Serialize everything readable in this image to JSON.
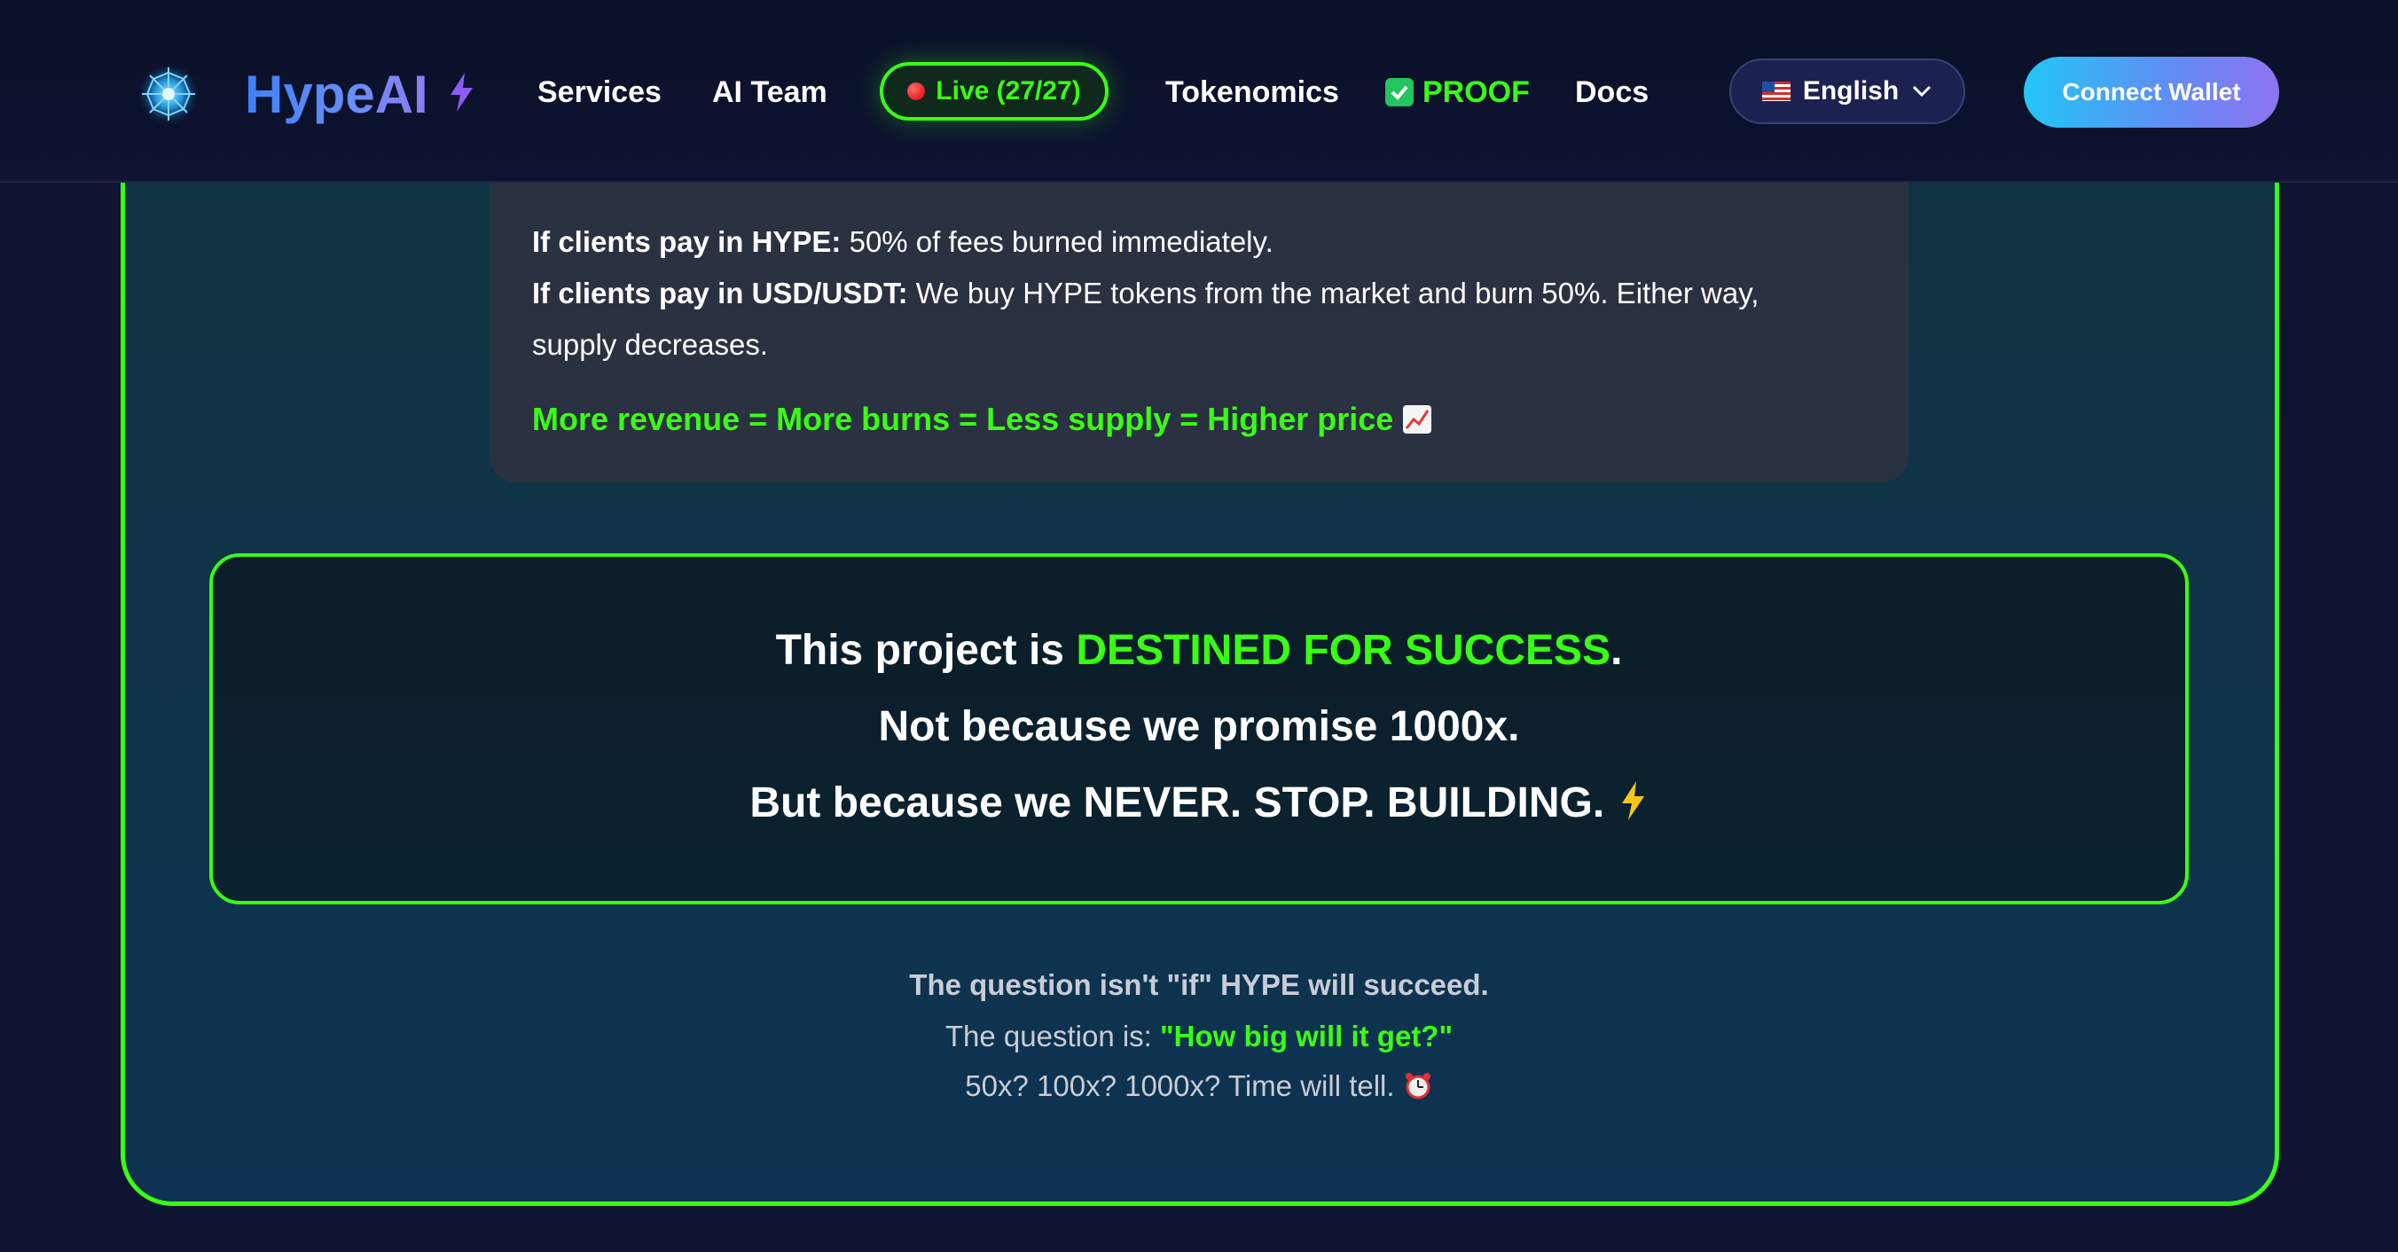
{
  "nav": {
    "brand": "HypeAI",
    "links": [
      "Services",
      "AI Team",
      "Tokenomics",
      "Docs"
    ],
    "live_label": "Live (27/27)",
    "proof_label": "PROOF",
    "language": "English",
    "connect_label": "Connect Wallet",
    "icons": [
      "network-logo-icon",
      "lightning-icon",
      "red-dot-icon",
      "checkmark-icon",
      "us-flag-icon",
      "chevron-down-icon"
    ]
  },
  "burn": {
    "hype_prefix": "If clients pay in HYPE:",
    "hype_text": " 50% of fees burned immediately.",
    "usd_prefix": "If clients pay in USD/USDT:",
    "usd_text": " We buy HYPE tokens from the market and burn 50%. Either way,",
    "usd_text_cont": "supply decreases.",
    "highlight": "More revenue = More burns = Less supply = Higher price"
  },
  "success": {
    "line1_pre": "This project is ",
    "line1_green": "DESTINED FOR SUCCESS",
    "line1_post": ".",
    "line2": "Not because we promise 1000x.",
    "line3": "But because we NEVER. STOP. BUILDING. "
  },
  "question": {
    "line1": "The question isn't \"if\" HYPE will succeed.",
    "line2_pre": "The question is: ",
    "line2_green": "\"How big will it get?\"",
    "line3": "50x? 100x? 1000x? Time will tell. "
  },
  "colors": {
    "accent_green": "#39ff14",
    "brand_blue": "#3b82f6",
    "background": "#0f1530"
  }
}
